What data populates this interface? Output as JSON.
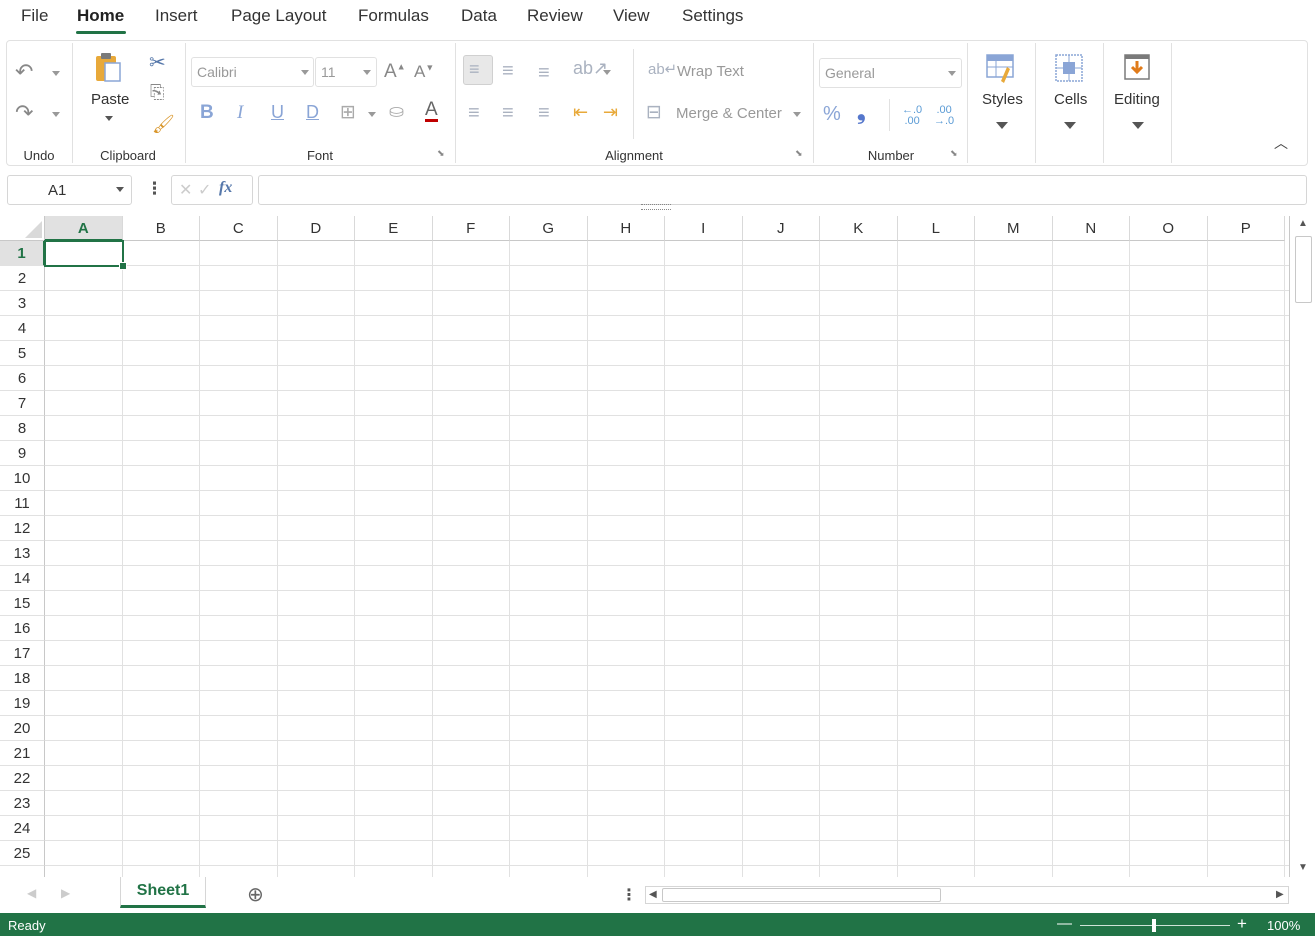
{
  "menu": {
    "items": [
      "File",
      "Home",
      "Insert",
      "Page Layout",
      "Formulas",
      "Data",
      "Review",
      "View",
      "Settings"
    ],
    "active": "Home"
  },
  "ribbon": {
    "groups": {
      "undo": "Undo",
      "clipboard": "Clipboard",
      "font": "Font",
      "alignment": "Alignment",
      "number": "Number"
    },
    "paste_label": "Paste",
    "font_name": "Calibri",
    "font_size": "11",
    "wrap_text": "Wrap Text",
    "merge_center": "Merge & Center",
    "number_format": "General",
    "styles": "Styles",
    "cells": "Cells",
    "editing": "Editing",
    "bold_glyph": "B",
    "italic_glyph": "I",
    "underline_glyph": "U",
    "strike_glyph": "D",
    "font_color_glyph": "A",
    "percent_glyph": "%",
    "comma_glyph": "❟",
    "inc_font_glyph": "A",
    "dec_font_glyph": "A",
    "fx_glyph": "fx"
  },
  "formula_bar": {
    "name_box": "A1",
    "formula": ""
  },
  "grid": {
    "columns": [
      "A",
      "B",
      "C",
      "D",
      "E",
      "F",
      "G",
      "H",
      "I",
      "J",
      "K",
      "L",
      "M",
      "N",
      "O",
      "P"
    ],
    "rows": [
      "1",
      "2",
      "3",
      "4",
      "5",
      "6",
      "7",
      "8",
      "9",
      "10",
      "11",
      "12",
      "13",
      "14",
      "15",
      "16",
      "17",
      "18",
      "19",
      "20",
      "21",
      "22",
      "23",
      "24",
      "25"
    ],
    "selected_column": "A",
    "selected_row": "1"
  },
  "sheets": {
    "tabs": [
      "Sheet1"
    ],
    "active": "Sheet1"
  },
  "status": {
    "text": "Ready",
    "zoom": "100%"
  },
  "colors": {
    "accent": "#217346"
  }
}
